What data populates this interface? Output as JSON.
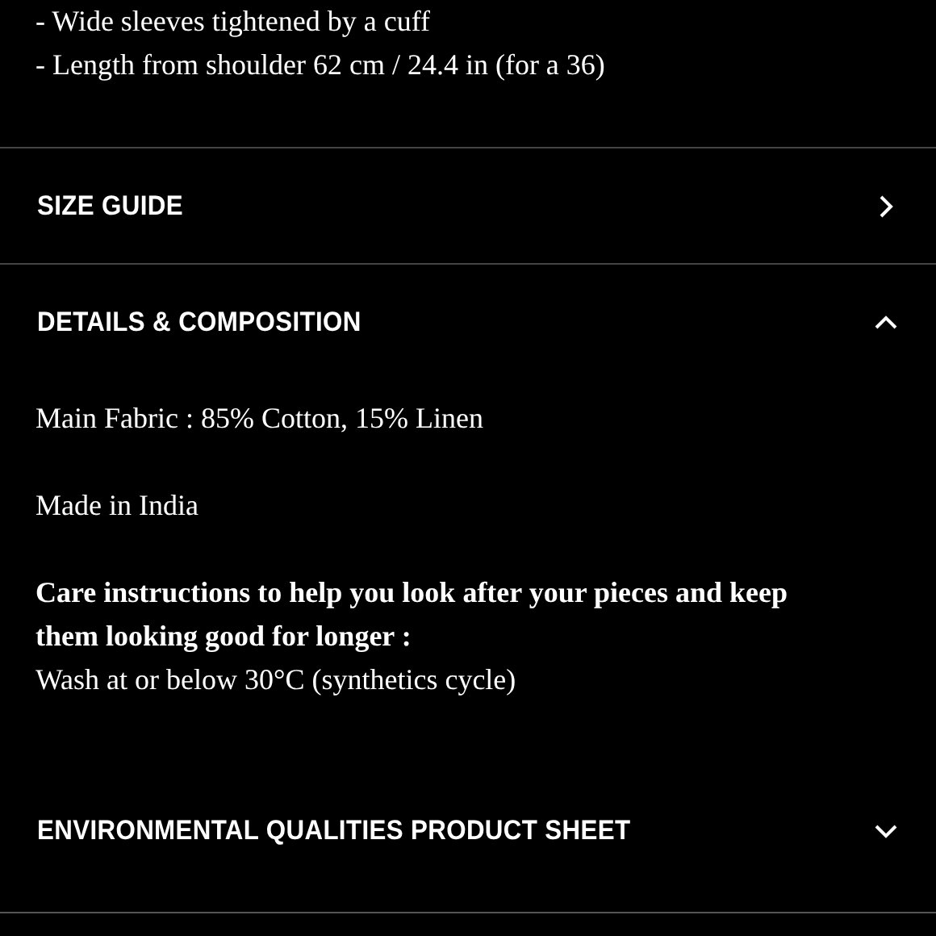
{
  "description_lines": [
    "- Wide sleeves tightened by a cuff",
    "- Length from shoulder 62 cm / 24.4 in (for a 36)"
  ],
  "sections": [
    {
      "title": "SIZE GUIDE",
      "kind": "link"
    },
    {
      "title": "DETAILS & COMPOSITION",
      "kind": "accordion",
      "expanded": true,
      "content": [
        {
          "text": "Main Fabric : 85% Cotton, 15% Linen"
        },
        {
          "text": "Made in India"
        },
        {
          "heading": "Care instructions to help you look after your pieces and keep them looking good for longer :",
          "text": "Wash at or below 30°C (synthetics cycle)"
        }
      ]
    },
    {
      "title": "ENVIRONMENTAL QUALITIES PRODUCT SHEET",
      "kind": "accordion",
      "expanded": false
    }
  ]
}
